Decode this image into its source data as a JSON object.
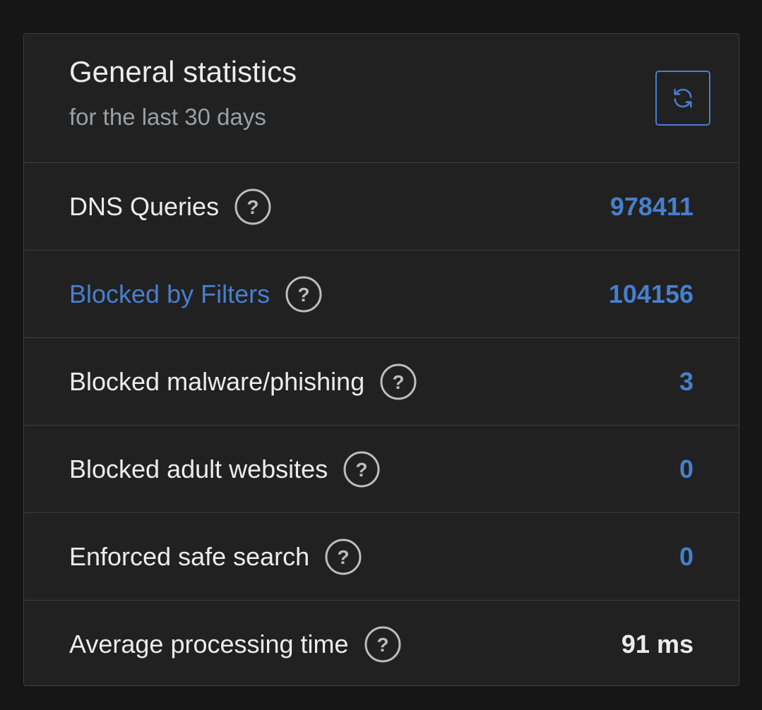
{
  "header": {
    "title": "General statistics",
    "subtitle": "for the last 30 days",
    "refresh_icon": "refresh-icon"
  },
  "stats": [
    {
      "label": "DNS Queries",
      "value": "978411",
      "label_is_link": false,
      "value_color": "#467fcf",
      "help_icon": "question-circle-icon"
    },
    {
      "label": "Blocked by Filters",
      "value": "104156",
      "label_is_link": true,
      "value_color": "#467fcf",
      "help_icon": "question-circle-icon"
    },
    {
      "label": "Blocked malware/phishing",
      "value": "3",
      "label_is_link": false,
      "value_color": "#467fcf",
      "help_icon": "question-circle-icon"
    },
    {
      "label": "Blocked adult websites",
      "value": "0",
      "label_is_link": false,
      "value_color": "#467fcf",
      "help_icon": "question-circle-icon"
    },
    {
      "label": "Enforced safe search",
      "value": "0",
      "label_is_link": false,
      "value_color": "#467fcf",
      "help_icon": "question-circle-icon"
    },
    {
      "label": "Average processing time",
      "value": "91 ms",
      "label_is_link": false,
      "value_color": "#ececec",
      "help_icon": "question-circle-icon"
    }
  ],
  "colors": {
    "accent": "#467fcf",
    "card_bg": "#212121",
    "page_bg": "#161616",
    "border": "#3e3e3e",
    "text": "#ececec",
    "muted": "#9aa0a6"
  }
}
